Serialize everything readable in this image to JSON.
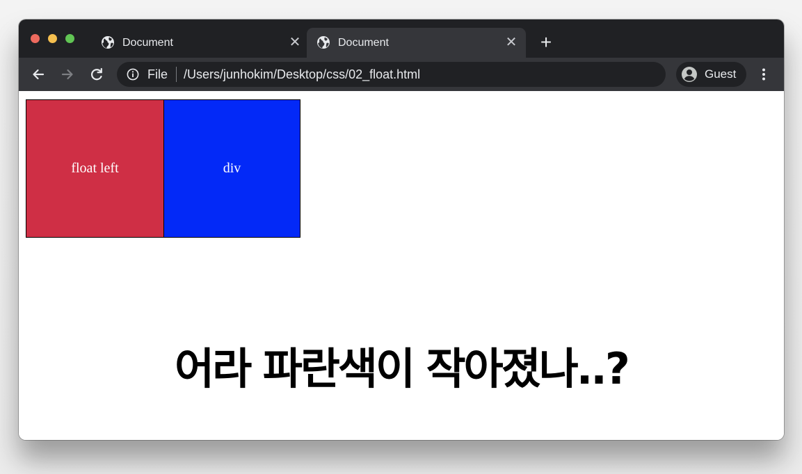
{
  "window": {
    "tabs": [
      {
        "title": "Document",
        "icon": "globe-icon",
        "active": false
      },
      {
        "title": "Document",
        "icon": "globe-icon",
        "active": true
      }
    ],
    "new_tab_label": "+",
    "close_glyph": "✕"
  },
  "toolbar": {
    "scheme_label": "File",
    "url": "/Users/junhokim/Desktop/css/02_float.html",
    "profile_label": "Guest"
  },
  "page": {
    "float_box_label": "float left",
    "div_box_label": "div",
    "caption": "어라 파란색이 작아졌나..?"
  },
  "colors": {
    "float_box": "#cf2f45",
    "div_box": "#0329f7",
    "tab_bar": "#202124",
    "toolbar": "#35363a"
  }
}
